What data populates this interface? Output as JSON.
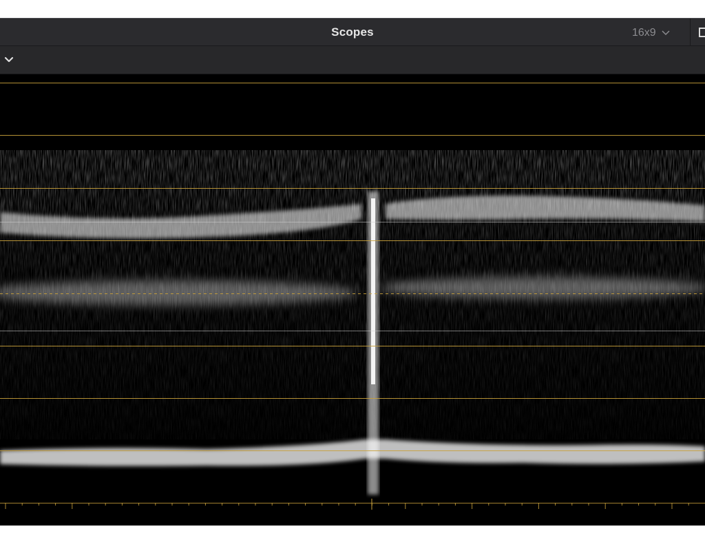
{
  "window": {
    "title": "Scopes",
    "aspect_label": "16x9"
  },
  "icons": {
    "aspect_dropdown": "chevron-down-icon",
    "toolbar_toggle": "chevron-down-icon",
    "panel_toggle": "panel-toggle-icon"
  },
  "colors": {
    "graticule": "#c9a13b",
    "trace": "#ffffff",
    "background": "#000000",
    "titlebar": "#2b2b2e"
  }
}
